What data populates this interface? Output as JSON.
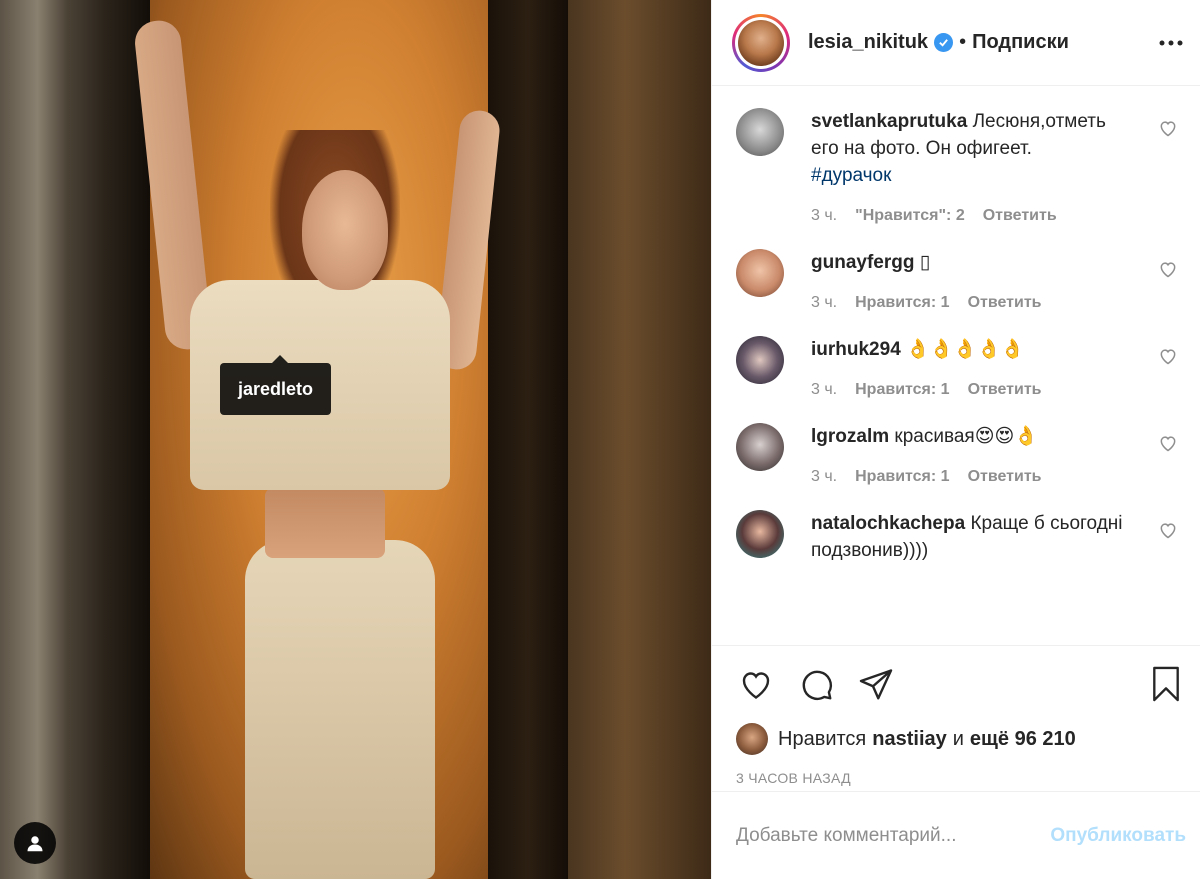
{
  "photo": {
    "tag_label": "jaredleto"
  },
  "header": {
    "username": "lesia_nikituk",
    "separator": "•",
    "follow_label": "Подписки"
  },
  "comments": [
    {
      "user": "svetlankaprutuka",
      "text": "Лесюня,отметь его на фото. Он офигеет.",
      "hashtag": "#дурачок",
      "time": "3 ч.",
      "likes": "\"Нравится\": 2",
      "reply": "Ответить",
      "avatar_color": "#9a9a9a"
    },
    {
      "user": "gunayfergg",
      "text": "▯",
      "hashtag": "",
      "time": "3 ч.",
      "likes": "Нравится: 1",
      "reply": "Ответить",
      "avatar_color": "#c98a6a"
    },
    {
      "user": "iurhuk294",
      "text": "👌👌👌👌👌",
      "hashtag": "",
      "time": "3 ч.",
      "likes": "Нравится: 1",
      "reply": "Ответить",
      "avatar_color": "#3b3b4a"
    },
    {
      "user": "lgrozalm",
      "text": "красивая😍😍👌",
      "hashtag": "",
      "time": "3 ч.",
      "likes": "Нравится: 1",
      "reply": "Ответить",
      "avatar_color": "#6a6a6a"
    },
    {
      "user": "natalochkachepa",
      "text": "Краще б сьогодні подзвонив))))",
      "hashtag": "",
      "time": "",
      "likes": "",
      "reply": "",
      "avatar_color": "#2f8a8a"
    }
  ],
  "likes": {
    "prefix": "Нравится",
    "user": "nastiiay",
    "and": "и",
    "count": "ещё 96 210"
  },
  "time_ago": "3 ЧАСОВ НАЗАД",
  "add_comment": {
    "placeholder": "Добавьте комментарий...",
    "publish_label": "Опубликовать"
  },
  "colors": {
    "verified": "#3897f0",
    "hashtag": "#00376b",
    "muted": "#8e8e8e",
    "publish_disabled": "#b2dffc"
  }
}
